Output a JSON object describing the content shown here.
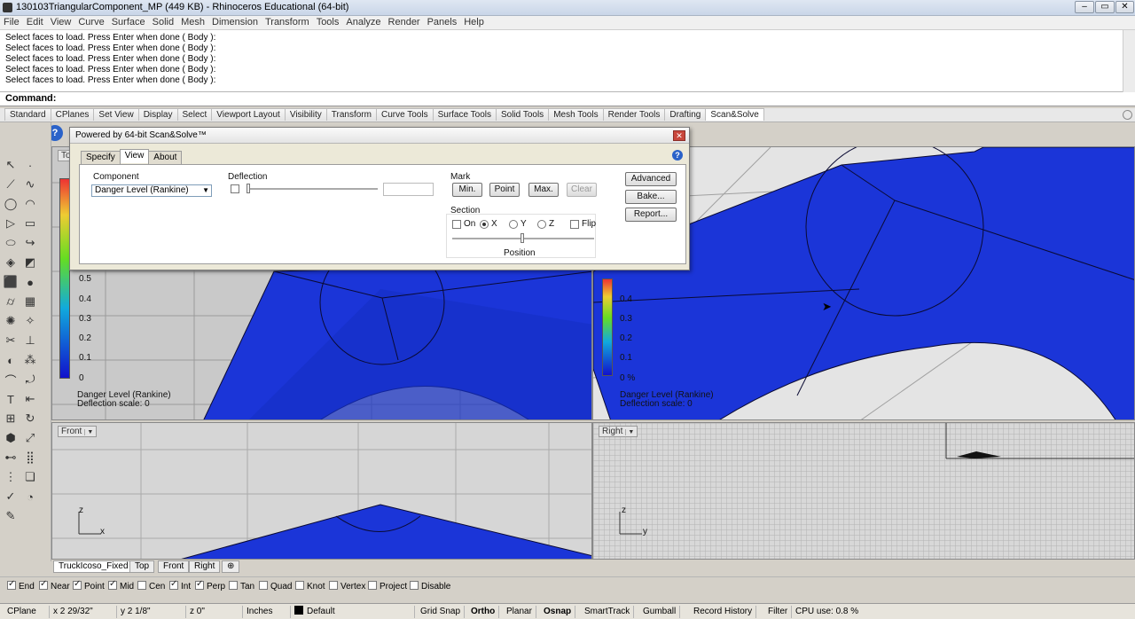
{
  "window": {
    "title": "130103TriangularComponent_MP (449 KB) - Rhinoceros Educational (64-bit)"
  },
  "menu": [
    "File",
    "Edit",
    "View",
    "Curve",
    "Surface",
    "Solid",
    "Mesh",
    "Dimension",
    "Transform",
    "Tools",
    "Analyze",
    "Render",
    "Panels",
    "Help"
  ],
  "history": [
    "Select faces to load. Press Enter when done ( Body ):",
    "Select faces to load. Press Enter when done ( Body ):",
    "Select faces to load. Press Enter when done ( Body ):",
    "Select faces to load. Press Enter when done ( Body ):",
    "Select faces to load. Press Enter when done ( Body ):"
  ],
  "command_label": "Command:",
  "toolbar_tabs": [
    "Standard",
    "CPlanes",
    "Set View",
    "Display",
    "Select",
    "Viewport Layout",
    "Visibility",
    "Transform",
    "Curve Tools",
    "Surface Tools",
    "Solid Tools",
    "Mesh Tools",
    "Render Tools",
    "Drafting",
    "Scan&Solve"
  ],
  "active_toolbar_tab": "Scan&Solve",
  "dialog": {
    "title": "Powered by 64-bit Scan&Solve™",
    "tabs": [
      "Specify",
      "View",
      "About"
    ],
    "active_tab": "View",
    "component_label": "Component",
    "component_value": "Danger Level (Rankine)",
    "deflection_label": "Deflection",
    "mark_label": "Mark",
    "mark_buttons": [
      "Min.",
      "Point",
      "Max.",
      "Clear"
    ],
    "section_label": "Section",
    "section_options": [
      "On",
      "X",
      "Y",
      "Z",
      "Flip"
    ],
    "position_label": "Position",
    "advanced": "Advanced",
    "bake": "Bake...",
    "report": "Report...",
    "help": "?"
  },
  "viewports": {
    "top": {
      "label": "Top",
      "ticks": [
        "0.5",
        "0.4",
        "0.3",
        "0.2",
        "0.1",
        "0"
      ],
      "caption1": "Danger Level (Rankine)",
      "caption2": "Deflection scale: 0"
    },
    "perspective": {
      "ticks": [
        "0.4",
        "0.3",
        "0.2",
        "0.1",
        "0 %"
      ],
      "caption1": "Danger Level (Rankine)",
      "caption2": "Deflection scale: 0"
    },
    "front": {
      "label": "Front",
      "axis_z": "z",
      "axis_x": "x"
    },
    "right": {
      "label": "Right",
      "axis_z": "z",
      "axis_y": "y"
    }
  },
  "viewport_tabs": [
    "TruckIcoso_Fixed",
    "Top",
    "Front",
    "Right",
    "⊕"
  ],
  "osnaps": [
    {
      "label": "End",
      "on": true
    },
    {
      "label": "Near",
      "on": true
    },
    {
      "label": "Point",
      "on": true
    },
    {
      "label": "Mid",
      "on": true
    },
    {
      "label": "Cen",
      "on": false
    },
    {
      "label": "Int",
      "on": true
    },
    {
      "label": "Perp",
      "on": true
    },
    {
      "label": "Tan",
      "on": false
    },
    {
      "label": "Quad",
      "on": false
    },
    {
      "label": "Knot",
      "on": false
    },
    {
      "label": "Vertex",
      "on": false
    },
    {
      "label": "Project",
      "on": false
    },
    {
      "label": "Disable",
      "on": false
    }
  ],
  "status": {
    "cplane": "CPlane",
    "x": "x 2 29/32\"",
    "y": "y 2 1/8\"",
    "z": "z 0\"",
    "units": "Inches",
    "layer": "Default",
    "grid_snap": "Grid Snap",
    "ortho": "Ortho",
    "planar": "Planar",
    "osnap": "Osnap",
    "smarttrack": "SmartTrack",
    "gumball": "Gumball",
    "record_history": "Record History",
    "filter": "Filter",
    "cpu": "CPU use: 0.8 %"
  },
  "colors": {
    "mesh_blue": "#1b35d8",
    "mesh_dark": "#1026a8",
    "legend_red": "#e33333",
    "legend_blue": "#1111cc"
  }
}
